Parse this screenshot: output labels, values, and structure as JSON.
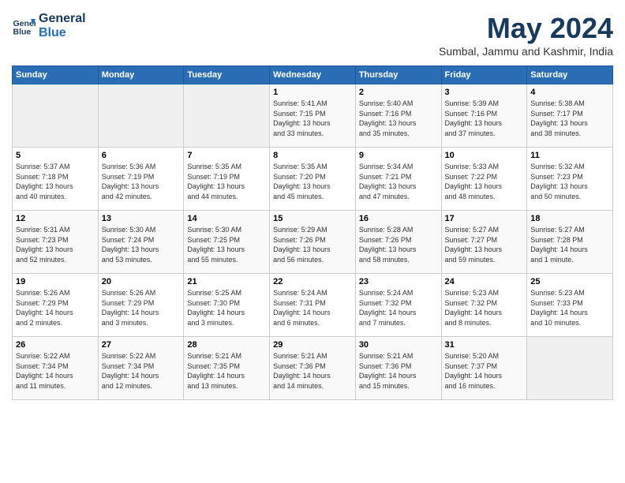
{
  "header": {
    "logo_line1": "General",
    "logo_line2": "Blue",
    "title": "May 2024",
    "subtitle": "Sumbal, Jammu and Kashmir, India"
  },
  "weekdays": [
    "Sunday",
    "Monday",
    "Tuesday",
    "Wednesday",
    "Thursday",
    "Friday",
    "Saturday"
  ],
  "weeks": [
    [
      {
        "day": "",
        "info": ""
      },
      {
        "day": "",
        "info": ""
      },
      {
        "day": "",
        "info": ""
      },
      {
        "day": "1",
        "info": "Sunrise: 5:41 AM\nSunset: 7:15 PM\nDaylight: 13 hours\nand 33 minutes."
      },
      {
        "day": "2",
        "info": "Sunrise: 5:40 AM\nSunset: 7:16 PM\nDaylight: 13 hours\nand 35 minutes."
      },
      {
        "day": "3",
        "info": "Sunrise: 5:39 AM\nSunset: 7:16 PM\nDaylight: 13 hours\nand 37 minutes."
      },
      {
        "day": "4",
        "info": "Sunrise: 5:38 AM\nSunset: 7:17 PM\nDaylight: 13 hours\nand 38 minutes."
      }
    ],
    [
      {
        "day": "5",
        "info": "Sunrise: 5:37 AM\nSunset: 7:18 PM\nDaylight: 13 hours\nand 40 minutes."
      },
      {
        "day": "6",
        "info": "Sunrise: 5:36 AM\nSunset: 7:19 PM\nDaylight: 13 hours\nand 42 minutes."
      },
      {
        "day": "7",
        "info": "Sunrise: 5:35 AM\nSunset: 7:19 PM\nDaylight: 13 hours\nand 44 minutes."
      },
      {
        "day": "8",
        "info": "Sunrise: 5:35 AM\nSunset: 7:20 PM\nDaylight: 13 hours\nand 45 minutes."
      },
      {
        "day": "9",
        "info": "Sunrise: 5:34 AM\nSunset: 7:21 PM\nDaylight: 13 hours\nand 47 minutes."
      },
      {
        "day": "10",
        "info": "Sunrise: 5:33 AM\nSunset: 7:22 PM\nDaylight: 13 hours\nand 48 minutes."
      },
      {
        "day": "11",
        "info": "Sunrise: 5:32 AM\nSunset: 7:23 PM\nDaylight: 13 hours\nand 50 minutes."
      }
    ],
    [
      {
        "day": "12",
        "info": "Sunrise: 5:31 AM\nSunset: 7:23 PM\nDaylight: 13 hours\nand 52 minutes."
      },
      {
        "day": "13",
        "info": "Sunrise: 5:30 AM\nSunset: 7:24 PM\nDaylight: 13 hours\nand 53 minutes."
      },
      {
        "day": "14",
        "info": "Sunrise: 5:30 AM\nSunset: 7:25 PM\nDaylight: 13 hours\nand 55 minutes."
      },
      {
        "day": "15",
        "info": "Sunrise: 5:29 AM\nSunset: 7:26 PM\nDaylight: 13 hours\nand 56 minutes."
      },
      {
        "day": "16",
        "info": "Sunrise: 5:28 AM\nSunset: 7:26 PM\nDaylight: 13 hours\nand 58 minutes."
      },
      {
        "day": "17",
        "info": "Sunrise: 5:27 AM\nSunset: 7:27 PM\nDaylight: 13 hours\nand 59 minutes."
      },
      {
        "day": "18",
        "info": "Sunrise: 5:27 AM\nSunset: 7:28 PM\nDaylight: 14 hours\nand 1 minute."
      }
    ],
    [
      {
        "day": "19",
        "info": "Sunrise: 5:26 AM\nSunset: 7:29 PM\nDaylight: 14 hours\nand 2 minutes."
      },
      {
        "day": "20",
        "info": "Sunrise: 5:26 AM\nSunset: 7:29 PM\nDaylight: 14 hours\nand 3 minutes."
      },
      {
        "day": "21",
        "info": "Sunrise: 5:25 AM\nSunset: 7:30 PM\nDaylight: 14 hours\nand 3 minutes."
      },
      {
        "day": "22",
        "info": "Sunrise: 5:24 AM\nSunset: 7:31 PM\nDaylight: 14 hours\nand 6 minutes."
      },
      {
        "day": "23",
        "info": "Sunrise: 5:24 AM\nSunset: 7:32 PM\nDaylight: 14 hours\nand 7 minutes."
      },
      {
        "day": "24",
        "info": "Sunrise: 5:23 AM\nSunset: 7:32 PM\nDaylight: 14 hours\nand 8 minutes."
      },
      {
        "day": "25",
        "info": "Sunrise: 5:23 AM\nSunset: 7:33 PM\nDaylight: 14 hours\nand 10 minutes."
      }
    ],
    [
      {
        "day": "26",
        "info": "Sunrise: 5:22 AM\nSunset: 7:34 PM\nDaylight: 14 hours\nand 11 minutes."
      },
      {
        "day": "27",
        "info": "Sunrise: 5:22 AM\nSunset: 7:34 PM\nDaylight: 14 hours\nand 12 minutes."
      },
      {
        "day": "28",
        "info": "Sunrise: 5:21 AM\nSunset: 7:35 PM\nDaylight: 14 hours\nand 13 minutes."
      },
      {
        "day": "29",
        "info": "Sunrise: 5:21 AM\nSunset: 7:36 PM\nDaylight: 14 hours\nand 14 minutes."
      },
      {
        "day": "30",
        "info": "Sunrise: 5:21 AM\nSunset: 7:36 PM\nDaylight: 14 hours\nand 15 minutes."
      },
      {
        "day": "31",
        "info": "Sunrise: 5:20 AM\nSunset: 7:37 PM\nDaylight: 14 hours\nand 16 minutes."
      },
      {
        "day": "",
        "info": ""
      }
    ]
  ]
}
